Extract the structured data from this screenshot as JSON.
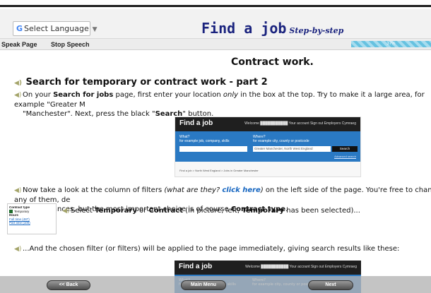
{
  "header": {
    "language_label": "Select Language",
    "title": "Find a job",
    "subtitle": "Step-by-step"
  },
  "speech": {
    "speak_page": "Speak Page",
    "stop_speech": "Stop Speech",
    "progress_percent": 37,
    "progress_label": "37%"
  },
  "page": {
    "heading": "Contract work.",
    "section_title": "Search for temporary or contract work - part 2",
    "para1_a": "On your ",
    "para1_b": "Search for jobs",
    "para1_c": " page, first enter your location ",
    "para1_d": "only",
    "para1_e": " in the box at the top. Try to make it a large area, for example \"Greater M",
    "para1_f": "\"Manchester\". Next, press the black \"",
    "para1_g": "Search",
    "para1_h": "\" button.",
    "para2_a": "Now take a look at the column of filters ",
    "para2_b": "(what are they? ",
    "para2_link": "click here",
    "para2_c": ")",
    "para2_d": " on the left side of the page. You're free to change any of them, de",
    "para2_e": "circumstances, but the most important choice is of course ",
    "para2_f": "Contract type",
    "para2_g": ".",
    "para3_a": "Select ",
    "para3_b": "Temporary",
    "para3_c": " or ",
    "para3_d": "Contract",
    "para3_e": " (in picture, left, ",
    "para3_f": "Temporary",
    "para3_g": " has been selected)...",
    "para4": "...And the chosen filter (or filters) will be applied to the page immediately, giving search results like these:"
  },
  "screenshot1": {
    "brand": "Find a job",
    "nav": "Welcome ███████████  Your account   Sign out   Employers   Cymraeg",
    "what_label": "What?",
    "what_hint": "for example job, company, skills",
    "where_label": "Where?",
    "where_hint": "for example city, county or postcode",
    "where_value": "Greater Manchester, North West England",
    "search_button": "Search",
    "advanced": "Advanced search",
    "breadcrumb": "Find a job  >  North West England  >  Jobs in Greater Manchester"
  },
  "filters_panel": {
    "contract_type": "Contract type",
    "temporary": "Temporary",
    "hours": "Hours",
    "full_time": "Full time (487)",
    "part_time": "Part time (100)"
  },
  "footer": {
    "back": "<< Back",
    "main_menu": "Main Menu",
    "next": "Next"
  },
  "colors": {
    "title": "#1a237e",
    "link": "#1565c0",
    "screenshot_blue": "#2a79c3"
  }
}
